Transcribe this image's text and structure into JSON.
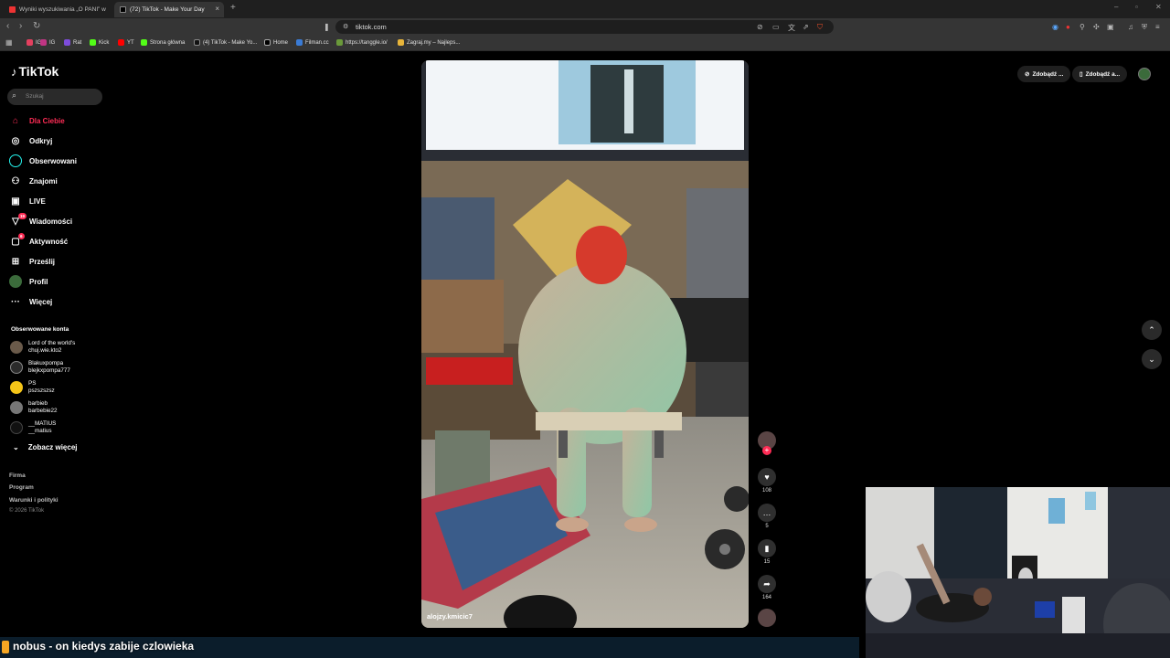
{
  "browser": {
    "tabs": [
      {
        "title": "Wyniki wyszukiwania „O PANI” w ser",
        "active": false
      },
      {
        "title": "(72) TikTok - Make Your Day",
        "active": true
      }
    ],
    "url": "tiktok.com",
    "bookmarks": [
      "IG",
      "Rat",
      "Kick",
      "YT",
      "Strona główna",
      "(4) TikTok - Make Yo...",
      "Home",
      "Filman.cc",
      "https://tanggle.io/",
      "Zagraj.my – Najleps..."
    ]
  },
  "tiktok": {
    "logo": "TikTok",
    "search_placeholder": "Szukaj",
    "nav": [
      {
        "label": "Dla Ciebie",
        "icon": "home-icon",
        "active": true
      },
      {
        "label": "Odkryj",
        "icon": "compass-icon"
      },
      {
        "label": "Obserwowani",
        "icon": "following-icon"
      },
      {
        "label": "Znajomi",
        "icon": "friends-icon"
      },
      {
        "label": "LIVE",
        "icon": "live-icon"
      },
      {
        "label": "Wiadomości",
        "icon": "messages-icon",
        "badge": "19"
      },
      {
        "label": "Aktywność",
        "icon": "activity-icon",
        "badge": "6"
      },
      {
        "label": "Prześlij",
        "icon": "upload-icon"
      },
      {
        "label": "Profil",
        "icon": "profile-icon"
      },
      {
        "label": "Więcej",
        "icon": "more-icon"
      }
    ],
    "followed_title": "Obserwowane konta",
    "followed": [
      {
        "name": "Lord of the world's",
        "handle": "chuj.wie.kto2"
      },
      {
        "name": "Blakuxpompa",
        "handle": "blejkxpompa777"
      },
      {
        "name": "PS",
        "handle": "pszszszsz"
      },
      {
        "name": "barbieb",
        "handle": "barbebie22"
      },
      {
        "name": "__MATIUS",
        "handle": "__matius"
      }
    ],
    "see_more": "Zobacz więcej",
    "footer": [
      "Firma",
      "Program",
      "Warunki i polityki",
      "© 2026 TikTok"
    ],
    "top_buttons": [
      "Zdobądź ...",
      "Zdobądź a..."
    ],
    "video": {
      "author": "alojzy.kmicic7",
      "likes": "108",
      "comments": "5",
      "saves": "15",
      "shares": "164"
    }
  },
  "stream_caption": "nobus - on kiedys zabije czlowieka"
}
